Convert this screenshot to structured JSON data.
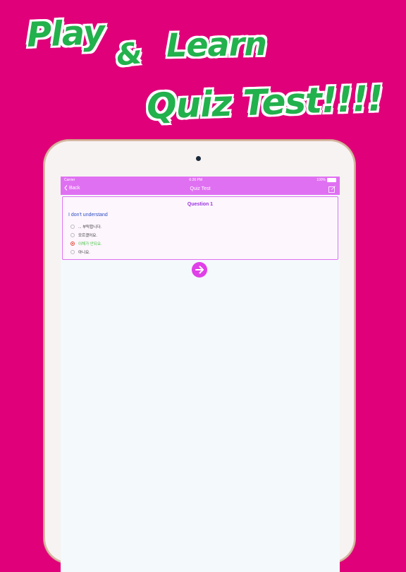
{
  "promo": {
    "play": "Play",
    "amp": "&",
    "learn": "Learn",
    "quiz": "Quiz Test!!!!"
  },
  "status": {
    "carrier": "Carrier",
    "time": "6:26 PM",
    "battery": "100%"
  },
  "nav": {
    "back": "Back",
    "title": "Quiz Test",
    "edit_icon": "compose-icon"
  },
  "quiz": {
    "header": "Question 1",
    "question": "I don't understand",
    "options": [
      {
        "label": "... 부탁합니다.",
        "selected": false
      },
      {
        "label": "모르겠어요.",
        "selected": false
      },
      {
        "label": "이해가 안되요.",
        "selected": true
      },
      {
        "label": "아니요.",
        "selected": false
      }
    ]
  },
  "next_icon": "arrow-right-icon",
  "colors": {
    "background": "#e0007a",
    "accent": "#e070f2",
    "promo_text": "#22b14c",
    "selected": "#e24b3c"
  }
}
